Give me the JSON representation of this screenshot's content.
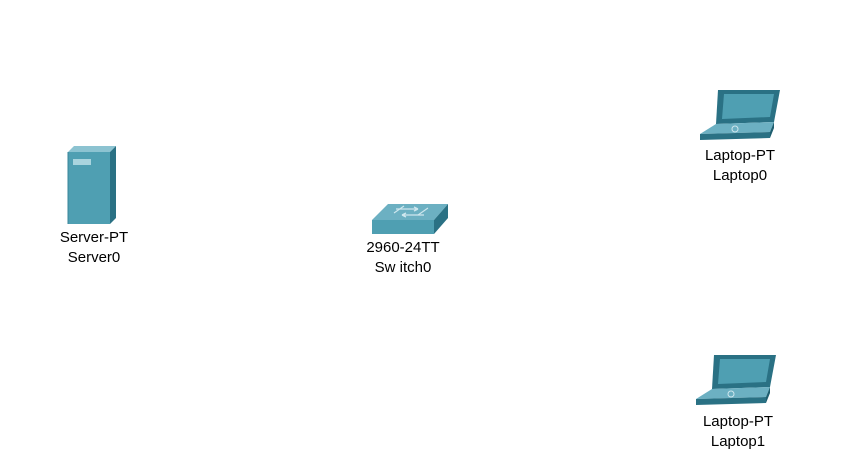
{
  "devices": [
    {
      "model": "Server-PT",
      "name": "Server0",
      "icon": "server-icon"
    },
    {
      "model": "2960-24TT",
      "name": "Sw itch0",
      "icon": "switch-icon"
    },
    {
      "model": "Laptop-PT",
      "name": "Laptop0",
      "icon": "laptop-icon"
    },
    {
      "model": "Laptop-PT",
      "name": "Laptop1",
      "icon": "laptop-icon"
    }
  ],
  "colors": {
    "device_front": "#4f9fb2",
    "device_side": "#2a7184",
    "device_top": "#8cc3d1",
    "background": "#ffffff"
  }
}
